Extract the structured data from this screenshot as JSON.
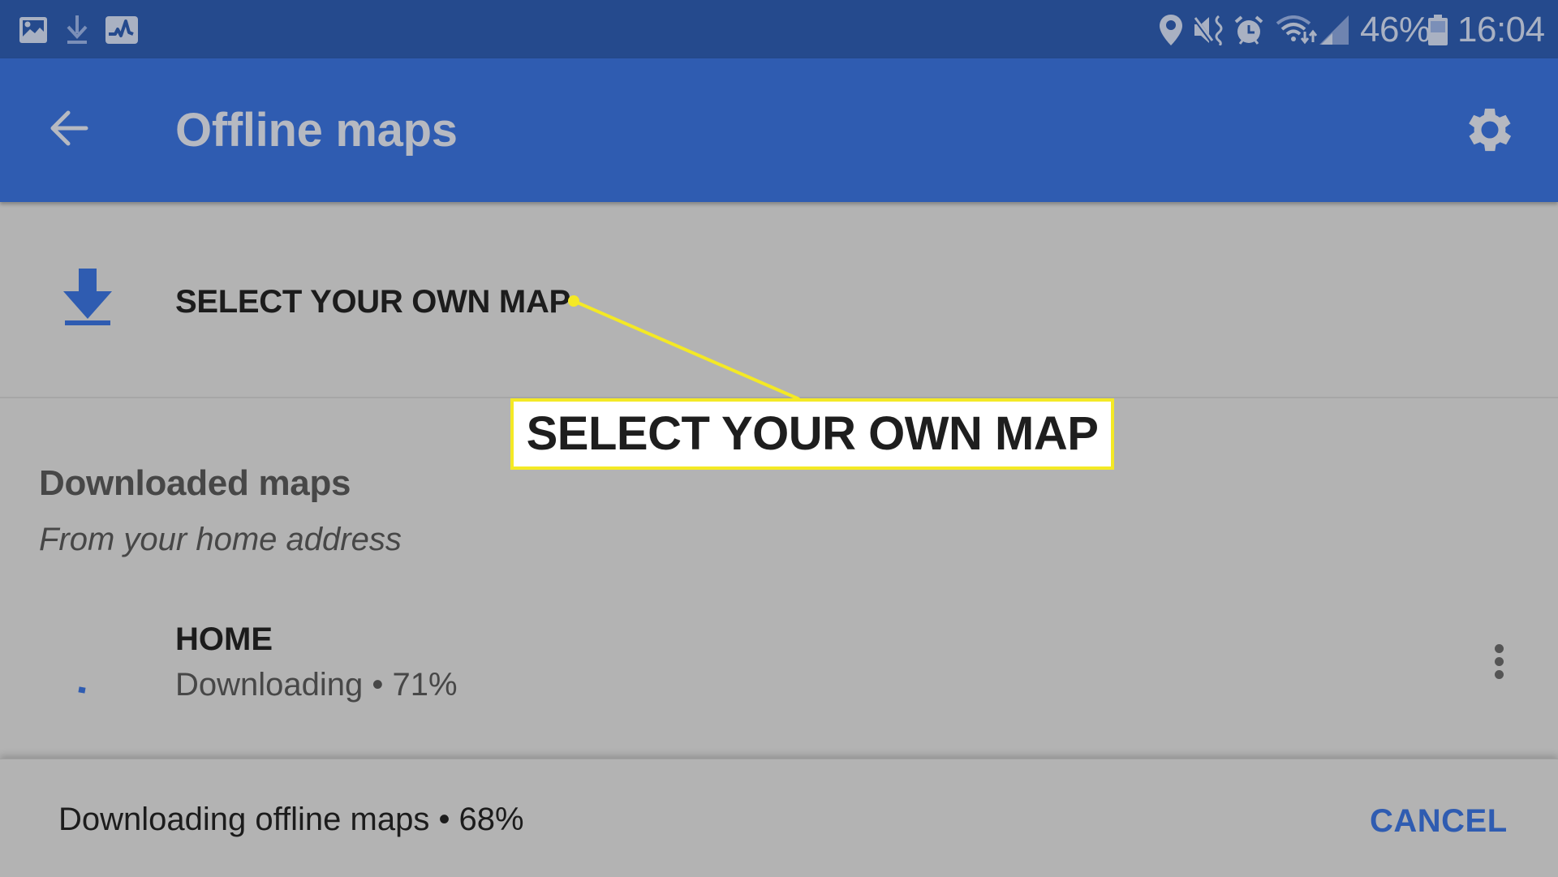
{
  "status_bar": {
    "left_icons": [
      "gallery-icon",
      "download-icon",
      "activity-icon"
    ],
    "right_icons": [
      "location-icon",
      "mute-vibrate-icon",
      "alarm-icon",
      "wifi-icon",
      "signal-icon"
    ],
    "battery_percent": "46%",
    "battery_icon": "battery-icon",
    "time": "16:04"
  },
  "app_bar": {
    "back_icon": "arrow-back-icon",
    "title": "Offline maps",
    "settings_icon": "gear-icon"
  },
  "select_map": {
    "icon": "download-icon",
    "label": "SELECT YOUR OWN MAP"
  },
  "downloaded": {
    "title": "Downloaded maps",
    "subtitle": "From your home address",
    "items": [
      {
        "name": "HOME",
        "status": "Downloading • 71%",
        "progress_percent": 71,
        "menu_icon": "more-vert-icon"
      }
    ]
  },
  "snackbar": {
    "message": "Downloading offline maps • 68%",
    "progress_percent": 68,
    "action_label": "CANCEL"
  },
  "annotation": {
    "callout_text": "SELECT YOUR OWN MAP",
    "color": "#f4e925"
  },
  "colors": {
    "status_bar": "#254a8d",
    "app_bar": "#2f5cb1",
    "background": "#b3b3b3",
    "accent": "#2f5cb1"
  }
}
